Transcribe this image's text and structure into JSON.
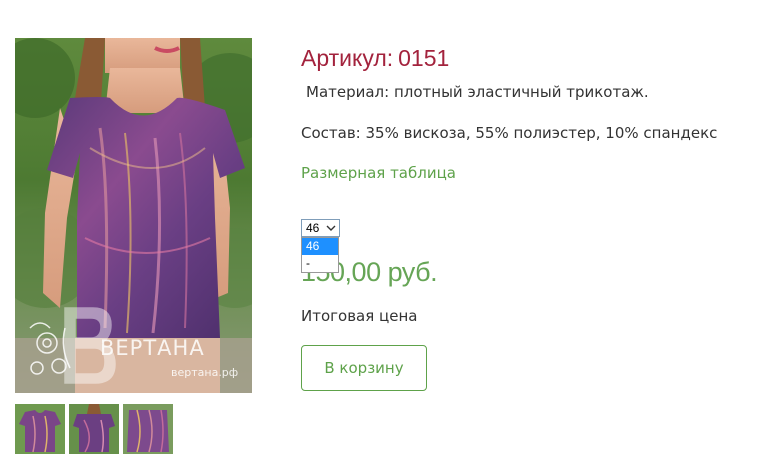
{
  "product": {
    "sku_label": "Артикул:",
    "sku_value": "0151",
    "material": "Материал: плотный эластичный трикотаж.",
    "composition": "Состав: 35% вискоза, 55% полиэстер, 10% спандекс",
    "size_table_link": "Размерная таблица",
    "price": "150,00 руб.",
    "price_label": "Итоговая цена",
    "cart_button": "В корзину"
  },
  "size_select": {
    "selected": "46",
    "options": [
      "46",
      "-"
    ],
    "highlighted": "46"
  },
  "watermark": {
    "brand": "ВЕРТАНА",
    "site": "вертана.рф"
  },
  "colors": {
    "sku": "#a3233d",
    "accent_green": "#5ea24a",
    "price_green": "#66a556",
    "highlight": "#1e90ff"
  },
  "thumbnails": [
    {
      "name": "front-view"
    },
    {
      "name": "back-view"
    },
    {
      "name": "detail-view"
    }
  ]
}
